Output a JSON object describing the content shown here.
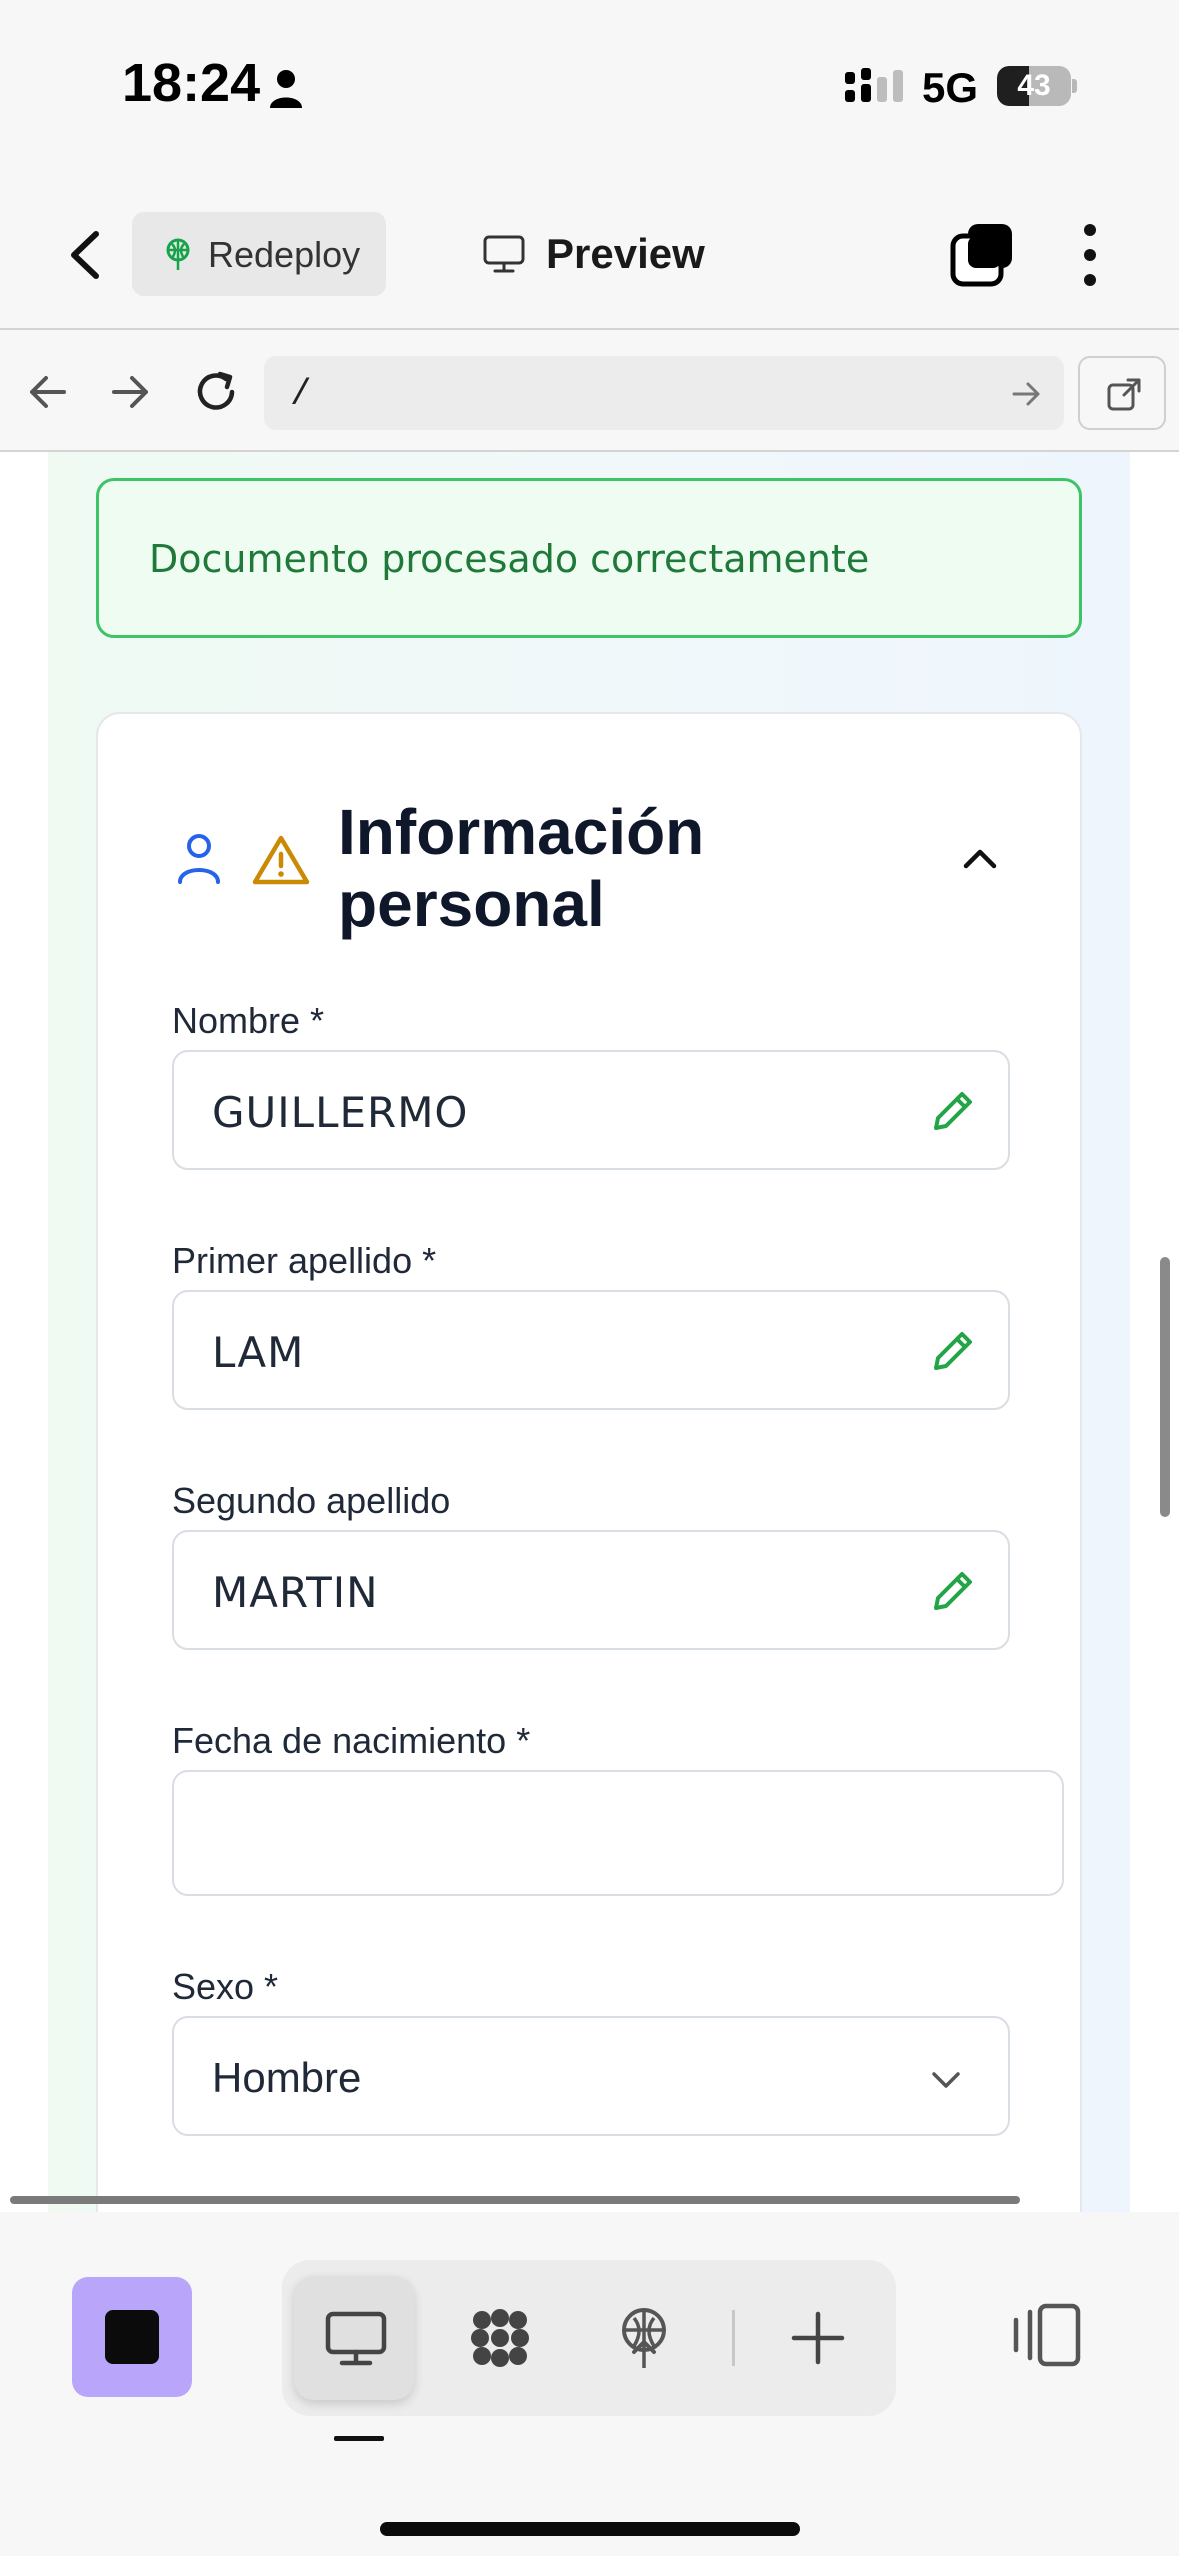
{
  "status_bar": {
    "time": "18:24",
    "network": "5G",
    "battery": "43",
    "battery_level": 0.43
  },
  "header": {
    "redeploy_label": "Redeploy",
    "preview_label": "Preview"
  },
  "browser": {
    "url": "/"
  },
  "alert": {
    "message": "Documento procesado correctamente"
  },
  "section": {
    "title": "Información personal"
  },
  "form": {
    "nombre_label": "Nombre *",
    "nombre_value": "GUILLERMO",
    "primer_apellido_label": "Primer apellido *",
    "primer_apellido_value": "LAM",
    "segundo_apellido_label": "Segundo apellido",
    "segundo_apellido_value": "MARTIN",
    "fecha_label": "Fecha de nacimiento *",
    "fecha_value": "",
    "sexo_label": "Sexo *",
    "sexo_value": "Hombre"
  },
  "colors": {
    "success_border": "#3cc466",
    "success_text": "#1f7a3a",
    "edit_icon": "#22a447",
    "person_icon": "#2563eb",
    "warning_icon": "#ca8a04",
    "stop_button": "#b9a6fb"
  },
  "icons": {
    "back": "chevron-left-icon",
    "redeploy": "antenna-icon",
    "preview": "monitor-icon",
    "tabs": "tabs-stack-icon",
    "more": "vertical-dots-icon",
    "edit": "pencil-icon",
    "section_person": "user-icon",
    "section_warning": "warning-triangle-icon",
    "collapse": "chevron-up-icon",
    "select": "chevron-down-icon"
  }
}
